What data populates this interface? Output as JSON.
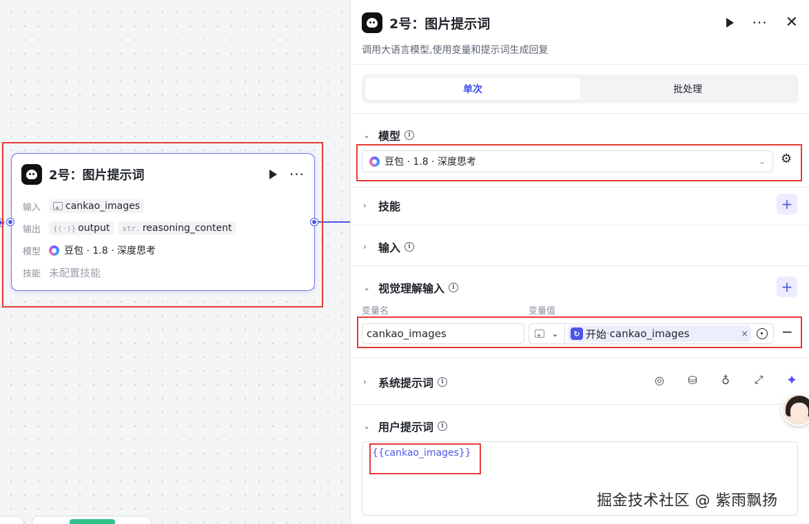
{
  "node": {
    "title": "2号：图片提示词",
    "rows": {
      "input_label": "输入",
      "input_chip": "cankao_images",
      "output_label": "输出",
      "output_chip1_prefix": "{(·)}",
      "output_chip1": "output",
      "output_chip2_prefix": "str.",
      "output_chip2": "reasoning_content",
      "model_label": "模型",
      "model_value": "豆包 · 1.8 · 深度思考",
      "skill_label": "技能",
      "skill_value": "未配置技能"
    }
  },
  "panel": {
    "title": "2号：图片提示词",
    "description": "调用大语言模型,使用变量和提示词生成回复",
    "tabs": [
      {
        "label": "单次",
        "active": true
      },
      {
        "label": "批处理",
        "active": false
      }
    ],
    "sections": {
      "model": "模型",
      "skills": "技能",
      "input": "输入",
      "vision_input": "视觉理解输入",
      "system_prompt": "系统提示词",
      "user_prompt": "用户提示词"
    },
    "model_select": {
      "value": "豆包 · 1.8 · 深度思考"
    },
    "vision": {
      "col_name": "变量名",
      "col_value": "变量值",
      "var_name": "cankao_images",
      "ref_source": "开始",
      "ref_sep": " · ",
      "ref_var": "cankao_images"
    },
    "user_prompt_text": "{{cankao_images}}"
  },
  "watermark": "掘金技术社区 @ 紫雨飘扬",
  "colors": {
    "accent": "#4c55e8",
    "highlight_box": "#e53935",
    "node_border": "#6c6ef2"
  },
  "icons": [
    "robot-icon",
    "play-icon",
    "more-icon",
    "close-icon",
    "image-icon",
    "doubao-logo-icon",
    "info-icon",
    "chevron-right-icon",
    "chevron-down-icon",
    "gear-icon",
    "plus-icon",
    "minus-icon",
    "target-icon",
    "compass-icon",
    "library-icon",
    "bulb-icon",
    "expand-icon",
    "sparkle-icon"
  ]
}
